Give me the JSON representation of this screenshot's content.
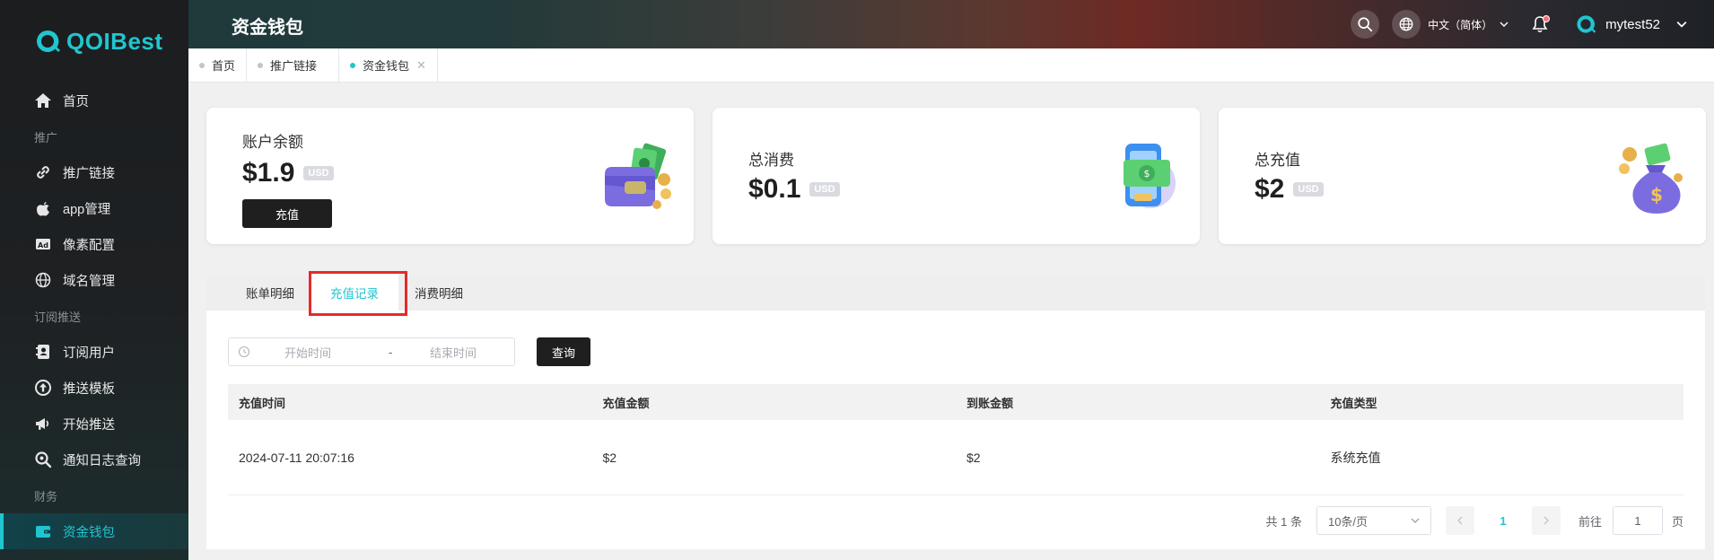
{
  "brand": {
    "name": "QOIBest",
    "color": "#20c6cf"
  },
  "sidebar": {
    "items": [
      {
        "type": "item",
        "label": "首页",
        "icon": "home-icon",
        "name": "sidebar-item-home"
      },
      {
        "type": "group",
        "label": "推广"
      },
      {
        "type": "item",
        "label": "推广链接",
        "icon": "link-icon",
        "name": "sidebar-item-promo-link"
      },
      {
        "type": "item",
        "label": "app管理",
        "icon": "apple-icon",
        "name": "sidebar-item-app"
      },
      {
        "type": "item",
        "label": "像素配置",
        "icon": "ad-icon",
        "name": "sidebar-item-pixel"
      },
      {
        "type": "item",
        "label": "域名管理",
        "icon": "globe-icon",
        "name": "sidebar-item-domain"
      },
      {
        "type": "group",
        "label": "订阅推送"
      },
      {
        "type": "item",
        "label": "订阅用户",
        "icon": "contact-icon",
        "name": "sidebar-item-subscribers"
      },
      {
        "type": "item",
        "label": "推送模板",
        "icon": "upload-circle-icon",
        "name": "sidebar-item-template"
      },
      {
        "type": "item",
        "label": "开始推送",
        "icon": "megaphone-icon",
        "name": "sidebar-item-push"
      },
      {
        "type": "item",
        "label": "通知日志查询",
        "icon": "search-log-icon",
        "name": "sidebar-item-logs"
      },
      {
        "type": "group",
        "label": "财务"
      },
      {
        "type": "item",
        "label": "资金钱包",
        "icon": "wallet-icon",
        "name": "sidebar-item-wallet",
        "active": true
      }
    ]
  },
  "header": {
    "title": "资金钱包",
    "language": "中文（简体）",
    "username": "mytest52",
    "has_notification": true
  },
  "page_tabs": [
    {
      "label": "首页",
      "active": false,
      "closable": false
    },
    {
      "label": "推广链接",
      "active": false,
      "closable": false
    },
    {
      "label": "资金钱包",
      "active": true,
      "closable": true
    }
  ],
  "cards": {
    "balance": {
      "label": "账户余额",
      "value": "$1.9",
      "currency": "USD",
      "button": "充值"
    },
    "spend": {
      "label": "总消费",
      "value": "$0.1",
      "currency": "USD"
    },
    "recharge": {
      "label": "总充值",
      "value": "$2",
      "currency": "USD"
    }
  },
  "panel": {
    "tabs": [
      {
        "label": "账单明细",
        "active": false
      },
      {
        "label": "充值记录",
        "active": true
      },
      {
        "label": "消费明细",
        "active": false
      }
    ],
    "filter": {
      "start_placeholder": "开始时间",
      "separator": "-",
      "end_placeholder": "结束时间",
      "query_button": "查询"
    },
    "table": {
      "columns": [
        "充值时间",
        "充值金额",
        "到账金额",
        "充值类型"
      ],
      "rows": [
        [
          "2024-07-11 20:07:16",
          "$2",
          "$2",
          "系统充值"
        ]
      ]
    },
    "pagination": {
      "total_text": "共 1 条",
      "page_size": "10条/页",
      "current_page": "1",
      "goto_label": "前往",
      "goto_value": "1",
      "goto_unit": "页"
    }
  },
  "colors": {
    "accent": "#20c6cf",
    "highlight": "#e52a2a",
    "dark_button": "#1f1f1f"
  }
}
